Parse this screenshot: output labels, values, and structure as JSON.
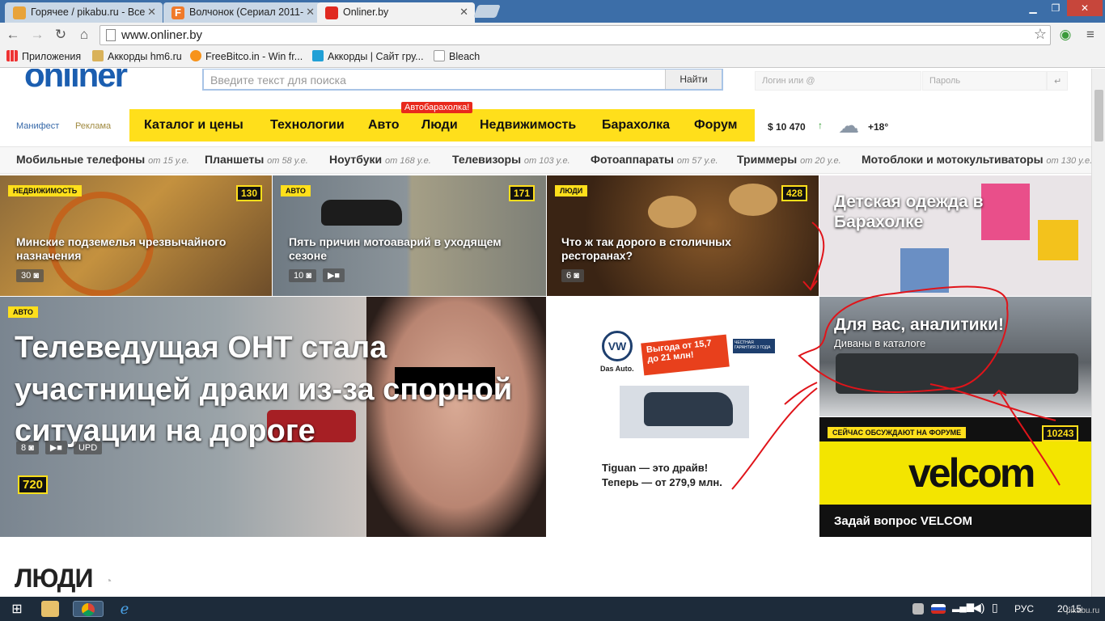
{
  "browser": {
    "tabs": [
      {
        "title": "Горячее / pikabu.ru - Все"
      },
      {
        "title": "Волчонок (Сериал 2011-"
      },
      {
        "title": "Onliner.by"
      }
    ],
    "url": "www.onliner.by",
    "bookmarks": [
      "Приложения",
      "Аккорды hm6.ru",
      "FreeBitco.in - Win fr...",
      "Аккорды | Сайт гру...",
      "Bleach"
    ]
  },
  "site": {
    "logo": "onliner",
    "search_placeholder": "Введите текст для поиска",
    "search_button": "Найти",
    "login_placeholder": "Логин или @",
    "password_placeholder": "Пароль",
    "top_links": [
      "Манифест",
      "Реклама"
    ],
    "nav": [
      "Каталог и цены",
      "Технологии",
      "Авто",
      "Люди",
      "Недвижимость",
      "Барахолка",
      "Форум"
    ],
    "nav_badge": "Автобарахолка!",
    "rate": "$ 10 470",
    "weather": "+18°",
    "categories": [
      {
        "name": "Мобильные телефоны",
        "price": "от 15 у.е."
      },
      {
        "name": "Планшеты",
        "price": "от 58 у.е."
      },
      {
        "name": "Ноутбуки",
        "price": "от 168 у.е."
      },
      {
        "name": "Телевизоры",
        "price": "от 103 у.е."
      },
      {
        "name": "Фотоаппараты",
        "price": "от 57 у.е."
      },
      {
        "name": "Триммеры",
        "price": "от 20 у.е."
      },
      {
        "name": "Мотоблоки и мотокультиваторы",
        "price": "от 130 у.е."
      }
    ]
  },
  "tiles": {
    "t1": {
      "label": "НЕДВИЖИМОСТЬ",
      "count": "130",
      "title": "Минские подземелья чрезвычайного назначения",
      "photos": "30"
    },
    "t2": {
      "label": "АВТО",
      "count": "171",
      "title": "Пять причин мотоаварий в уходящем сезоне",
      "photos": "10"
    },
    "t3": {
      "label": "ЛЮДИ",
      "count": "428",
      "title": "Что ж так дорого в столичных ресторанах?",
      "photos": "6"
    },
    "t4": {
      "title": "Детская одежда в Барахолке"
    },
    "big": {
      "label": "АВТО",
      "title": "Телеведущая ОНТ стала участницей драки из-за спорной ситуации на дороге",
      "photos": "8",
      "upd": "UPD",
      "count": "720"
    },
    "ad": {
      "brand": "Das Auto.",
      "promo": "Выгода от 15,7 до 21 млн!",
      "warranty": "ЧЕСТНАЯ ГАРАНТИЯ 3 ГОДА",
      "line1": "Tiguan — это драйв!",
      "line2": "Теперь — от 279,9 млн."
    },
    "sofa": {
      "title": "Для вас, аналитики!",
      "sub": "Диваны в каталоге"
    },
    "velcom": {
      "label": "СЕЙЧАС ОБСУЖДАЮТ НА ФОРУМЕ",
      "count": "10243",
      "logo": "velcom",
      "title": "Задай вопрос VELCOM"
    }
  },
  "section_heading": "ЛЮДИ",
  "taskbar": {
    "lang": "РУС",
    "time": "20:15",
    "watermark": "pikabu.ru"
  }
}
